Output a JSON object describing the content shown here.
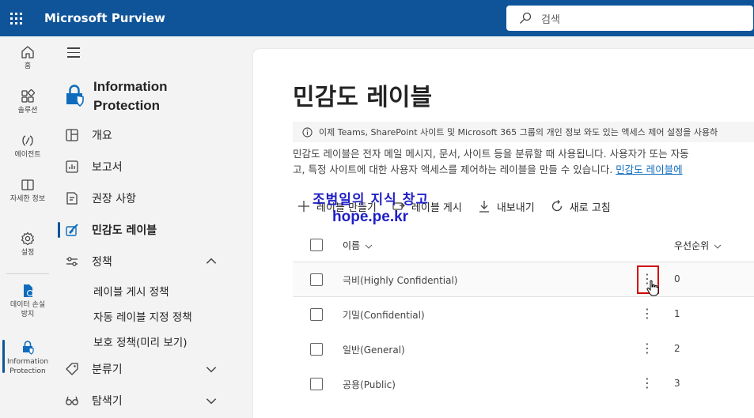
{
  "app": {
    "title": "Microsoft Purview"
  },
  "search": {
    "placeholder": "검색"
  },
  "rail": {
    "items": [
      {
        "label": "홈",
        "icon": "home-icon"
      },
      {
        "label": "솔루션",
        "icon": "apps-icon"
      },
      {
        "label": "에이전트",
        "icon": "agent-icon"
      },
      {
        "label": "자세한 정보",
        "icon": "book-icon"
      },
      {
        "label": "설정",
        "icon": "gear-icon"
      },
      {
        "label": "데이터 손실 방지",
        "icon": "dlp-icon"
      },
      {
        "label": "Information Protection",
        "icon": "info-protection-icon"
      }
    ]
  },
  "sidenav": {
    "header": "Information Protection",
    "items": [
      {
        "label": "개요",
        "icon": "overview-icon"
      },
      {
        "label": "보고서",
        "icon": "report-icon"
      },
      {
        "label": "권장 사항",
        "icon": "recommendation-icon"
      },
      {
        "label": "민감도 레이블",
        "icon": "label-icon"
      },
      {
        "label": "정책",
        "icon": "policy-icon"
      },
      {
        "label": "분류기",
        "icon": "classifier-icon"
      },
      {
        "label": "탐색기",
        "icon": "explorer-icon"
      }
    ],
    "sub_items": [
      "레이블 게시 정책",
      "자동 레이블 지정 정책",
      "보호 정책(미리 보기)"
    ]
  },
  "main": {
    "title": "민감도 레이블",
    "info": "이제 Teams, SharePoint 사이트 및 Microsoft 365 그룹의 개인 정보 와도 있는 액세스 제어 설정을 사용하",
    "desc_line1": "민감도 레이블은 전자 메일 메시지, 문서, 사이트 등을 분류할 때 사용됩니다. 사용자가 또는 자동",
    "desc_line2": "고, 특정 사이트에 대한 사용자 액세스를 제어하는 레이블을 만들 수 있습니다. ",
    "desc_link": "민감도 레이블에",
    "toolbar": {
      "create": "레이블 만들기",
      "publish": "레이블 게시",
      "export": "내보내기",
      "refresh": "새로 고침"
    },
    "watermark": {
      "line1": "조범일의 지식 창고",
      "line2": "hope.pe.kr"
    },
    "table": {
      "col_name": "이름",
      "col_priority": "우선순위",
      "rows": [
        {
          "name": "극비(Highly Confidential)",
          "priority": "0"
        },
        {
          "name": "기밀(Confidential)",
          "priority": "1"
        },
        {
          "name": "일반(General)",
          "priority": "2"
        },
        {
          "name": "공용(Public)",
          "priority": "3"
        }
      ]
    }
  }
}
